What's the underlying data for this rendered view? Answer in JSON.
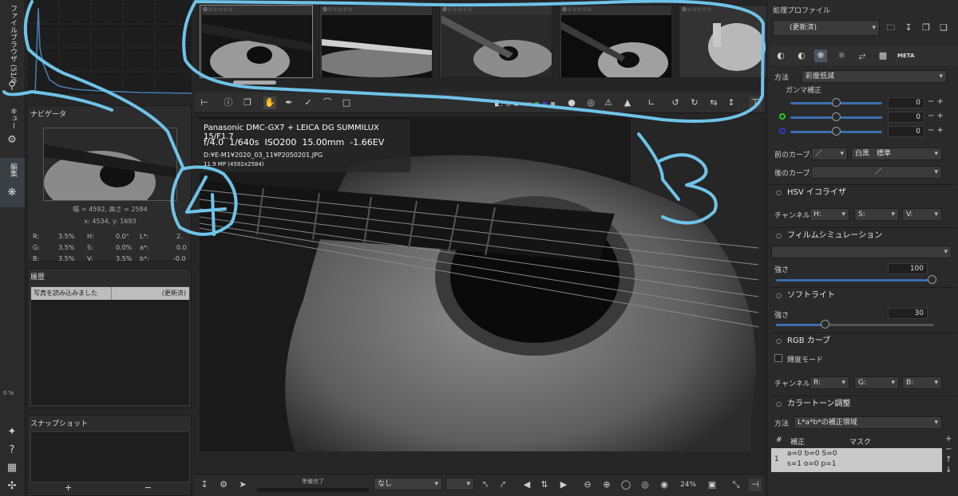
{
  "left_tabs": {
    "file_browser": "ファイルブラウザ (51/0",
    "queue": "キュー",
    "edit": "編集"
  },
  "histogram_zoom": "0 %",
  "navigator": {
    "title": "ナビゲータ",
    "size": "幅 = 4592, 高さ = 2584",
    "coords": "x: 4534, y: 1693",
    "r_label": "R:",
    "r_val": "3.5%",
    "g_label": "G:",
    "g_val": "3.5%",
    "b_label": "B:",
    "b_val": "3.5%",
    "h_label": "H:",
    "h_val": "0.0°",
    "s_label": "S:",
    "s_val": "0.0%",
    "v_label": "V:",
    "v_val": "3.5%",
    "l_label": "L*:",
    "l_val": "2.",
    "a_label": "a*:",
    "a_val": "0.0",
    "bs_label": "b*:",
    "bs_val": "-0.0"
  },
  "history": {
    "title": "履歴",
    "row_label": "写真を読み込みました",
    "row_state": "(更新済)"
  },
  "snapshot": {
    "title": "スナップショット",
    "add": "+",
    "remove": "−"
  },
  "exif": {
    "camera": "Panasonic DMC-GX7 + LEICA DG SUMMILUX 15/F1.7",
    "aperture": "f/4.0",
    "shutter": "1/640s",
    "iso": "ISO200",
    "focal": "15.00mm",
    "ev": "-1.66EV",
    "path": "D:¥E-M1¥2020_03_11¥P2050201.JPG",
    "mp": "11.9 MP (4592x2584)"
  },
  "bottom": {
    "status": "準備完了",
    "preset": "なし",
    "zoom": "24%"
  },
  "right": {
    "profile_label": "処理プロファイル",
    "profile_value": "(更新済)",
    "method_label": "方法",
    "method_value": "彩度低減",
    "gamma_label": "ガンマ補正",
    "val1": "0",
    "val2": "0",
    "val3": "0",
    "pre_curve_label": "前のカーブ:",
    "pre_curve_type": "白黒　標準",
    "post_curve_label": "後のカーブ:",
    "hsv_title": "HSV イコライザ",
    "channel_label": "チャンネル:",
    "ch_h": "H:",
    "ch_s": "S:",
    "ch_v": "V:",
    "film_title": "フィルムシミュレーション",
    "strength_label": "強さ",
    "film_strength": "100",
    "softlight_title": "ソフトライト",
    "soft_strength": "30",
    "rgb_title": "RGB カーブ",
    "lum_mode": "輝度モード",
    "ch_r": "R:",
    "ch_g": "G:",
    "ch_b": "B:",
    "colortone_title": "カラートーン調整",
    "ct_method_value": "L*a*b*の補正領域",
    "col_num": "#",
    "col_corr": "補正",
    "col_mask": "マスク",
    "row_num": "1",
    "row_line1": "a=0 b=0 S=0",
    "row_line2": "s=1 o=0 p=1"
  },
  "meta_tab": "META",
  "annotations": {
    "three": "3",
    "four": "4"
  }
}
